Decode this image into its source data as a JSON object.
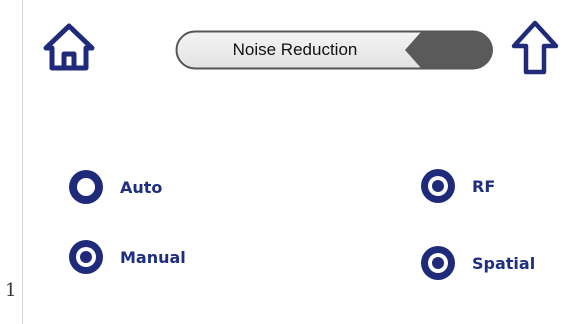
{
  "header": {
    "title": "Noise Reduction"
  },
  "options": {
    "auto": {
      "label": "Auto",
      "selected": false
    },
    "manual": {
      "label": "Manual",
      "selected": true
    },
    "rf": {
      "label": "RF",
      "selected": true
    },
    "spatial": {
      "label": "Spatial",
      "selected": true
    }
  },
  "page_number": "1",
  "icons": {
    "home": "home-icon",
    "up": "up-arrow-icon"
  },
  "colors": {
    "radio_ring": "#1f2a7a",
    "label_text": "#1f2f80",
    "pill_gray": "#5a5a5a"
  }
}
